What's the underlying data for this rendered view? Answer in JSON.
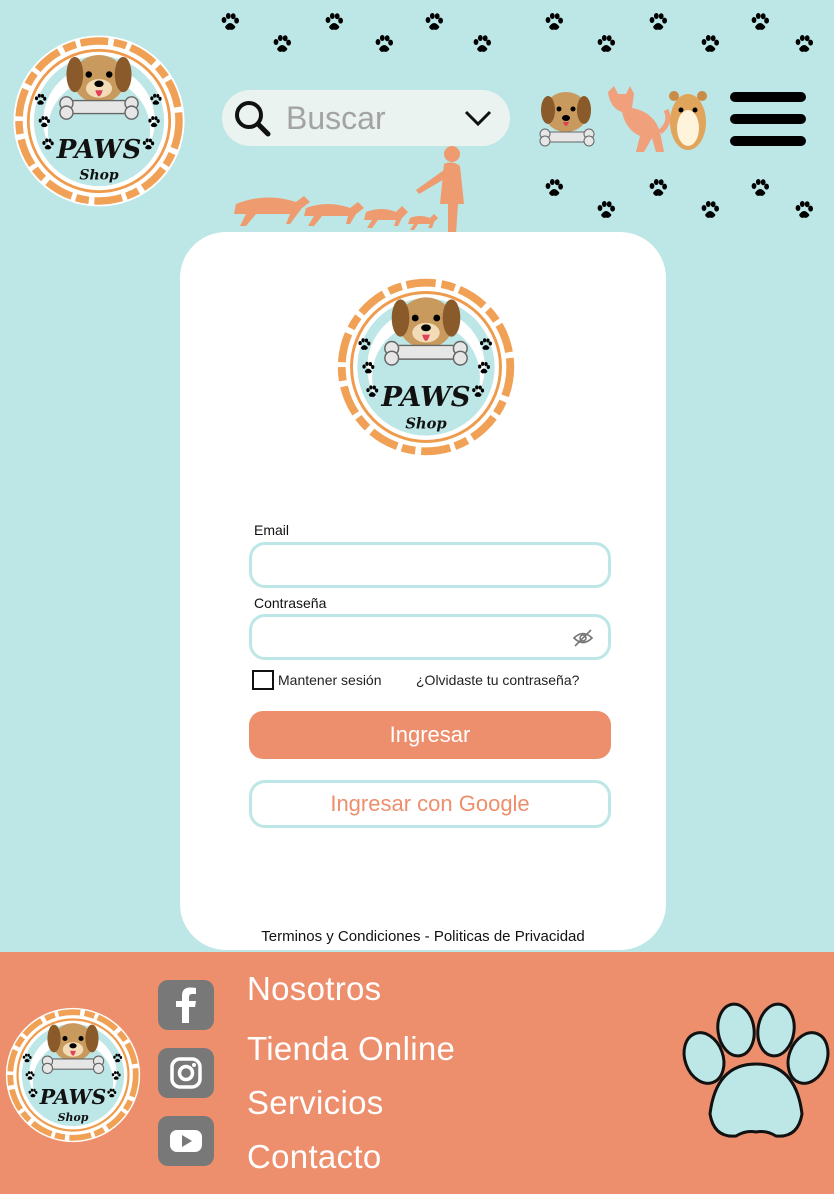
{
  "header": {
    "brand": {
      "line1": "PAWS",
      "line2": "Shop"
    },
    "search": {
      "placeholder": "Buscar"
    }
  },
  "login": {
    "email_label": "Email",
    "password_label": "Contraseña",
    "remember_label": "Mantener sesión",
    "forgot_link": "¿Olvidaste tu contraseña?",
    "login_button": "Ingresar",
    "google_button": "Ingresar con Google"
  },
  "legal": {
    "terms": "Terminos y Condiciones - Politicas de Privacidad"
  },
  "footer": {
    "links": [
      "Nosotros",
      "Tienda Online",
      "Servicios",
      "Contacto"
    ],
    "social": [
      "facebook-icon",
      "instagram-icon",
      "youtube-icon"
    ]
  },
  "colors": {
    "background": "#bde6e6",
    "accent": "#ed8f6d",
    "card": "#ffffff",
    "menu": "#000000",
    "social": "#787878"
  }
}
